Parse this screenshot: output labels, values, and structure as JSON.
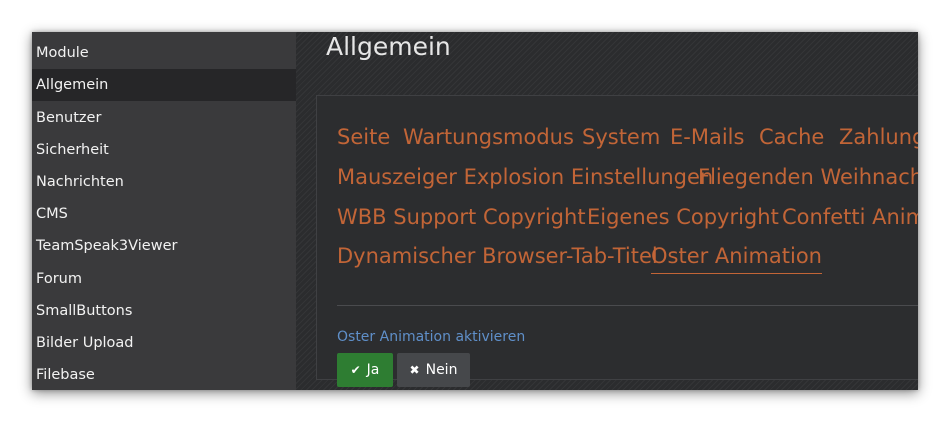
{
  "sidebar": {
    "items": [
      {
        "label": "Module"
      },
      {
        "label": "Allgemein",
        "active": true
      },
      {
        "label": "Benutzer"
      },
      {
        "label": "Sicherheit"
      },
      {
        "label": "Nachrichten"
      },
      {
        "label": "CMS"
      },
      {
        "label": "TeamSpeak3Viewer"
      },
      {
        "label": "Forum"
      },
      {
        "label": "SmallButtons"
      },
      {
        "label": "Bilder Upload"
      },
      {
        "label": "Filebase"
      }
    ]
  },
  "main": {
    "title": "Allgemein",
    "tabs": [
      {
        "label": "Seite"
      },
      {
        "label": "Wartungsmodus"
      },
      {
        "label": "System"
      },
      {
        "label": "E-Mails"
      },
      {
        "label": "Cache"
      },
      {
        "label": "Zahlung"
      },
      {
        "label": "Mauszeiger Explosion Einstellungen"
      },
      {
        "label": "Fliegenden Weihnachts"
      },
      {
        "label": "WBB Support Copyright"
      },
      {
        "label": "Eigenes Copyright"
      },
      {
        "label": "Confetti Anima"
      },
      {
        "label": "Dynamischer Browser-Tab-Titel"
      },
      {
        "label": "Oster Animation",
        "active": true
      }
    ],
    "option": {
      "label": "Oster Animation aktivieren",
      "yes_label": "Ja",
      "no_label": "Nein",
      "yes_icon": "check-icon",
      "no_icon": "close-icon"
    }
  },
  "colors": {
    "tab_text": "#c26537",
    "option_label": "#5f8fc9",
    "yes_button": "#2e7d32",
    "no_button": "#46484b",
    "sidebar_bg": "#3a3a3c",
    "sidebar_active_bg": "#262628"
  }
}
